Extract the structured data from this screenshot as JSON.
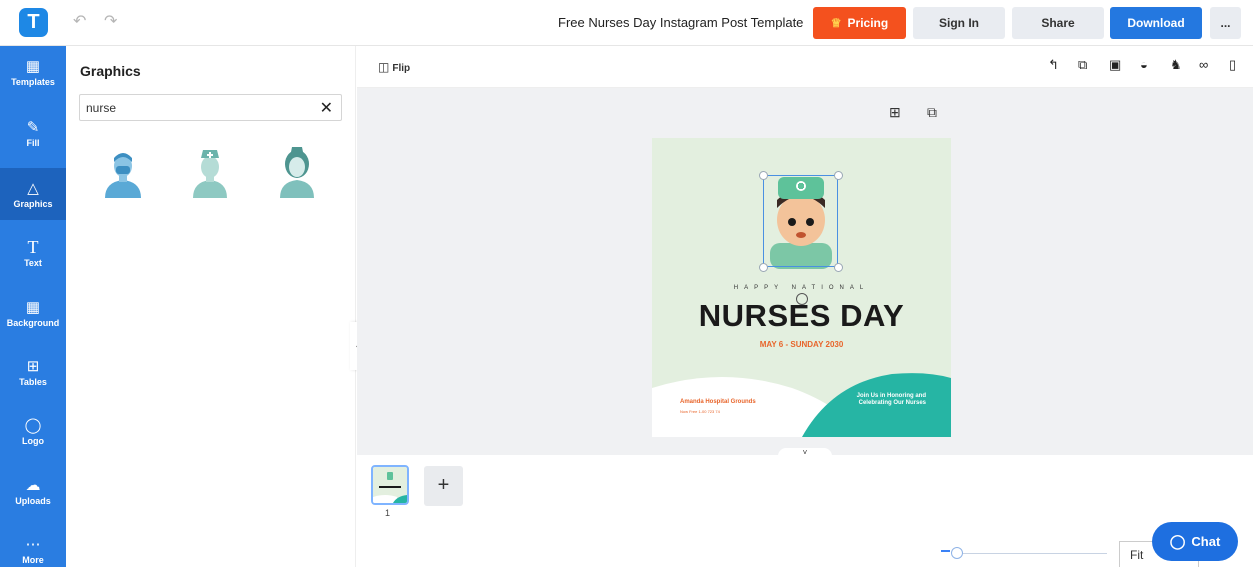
{
  "app": {
    "logo_letter": "T",
    "brand_color": "#2a7de1"
  },
  "header": {
    "title": "Free Nurses Day Instagram Post Template",
    "undo_icon": "undo-icon",
    "redo_icon": "redo-icon",
    "pricing_label": "Pricing",
    "signin_label": "Sign In",
    "share_label": "Share",
    "download_label": "Download",
    "more_label": "..."
  },
  "sidebar": {
    "items": [
      {
        "label": "Templates",
        "icon": "templates-icon"
      },
      {
        "label": "Fill",
        "icon": "pencil-icon"
      },
      {
        "label": "Graphics",
        "icon": "shapes-icon",
        "active": true
      },
      {
        "label": "Text",
        "icon": "text-icon"
      },
      {
        "label": "Background",
        "icon": "background-icon"
      },
      {
        "label": "Tables",
        "icon": "table-icon"
      },
      {
        "label": "Logo",
        "icon": "logo-icon"
      },
      {
        "label": "Uploads",
        "icon": "upload-icon"
      },
      {
        "label": "More",
        "icon": "more-icon"
      }
    ]
  },
  "panel": {
    "title": "Graphics",
    "search_value": "nurse",
    "results": [
      "male-nurse-graphic",
      "female-nurse-cap-graphic",
      "female-nurse-graphic"
    ]
  },
  "canvas_toolbar": {
    "flip_label": "Flip",
    "tools": [
      "paint-roller-icon",
      "copy-icon",
      "layer-icon",
      "opacity-icon",
      "pin-icon",
      "link-icon",
      "trash-icon"
    ]
  },
  "design": {
    "subtitle": "HAPPY NATIONAL",
    "title": "NURSES DAY",
    "date": "MAY 6 - SUNDAY 2030",
    "hospital": "Amanda Hospital Grounds",
    "phone": "Now Free 1-00 723 74",
    "join_text": "Join Us in Honoring and Celebrating Our Nurses",
    "bg_color": "#e3efdf",
    "accent_teal": "#26b5a4",
    "accent_orange": "#e8652b"
  },
  "pages": {
    "current": "1"
  },
  "zoom": {
    "value": "Fit"
  },
  "chat": {
    "label": "Chat"
  }
}
